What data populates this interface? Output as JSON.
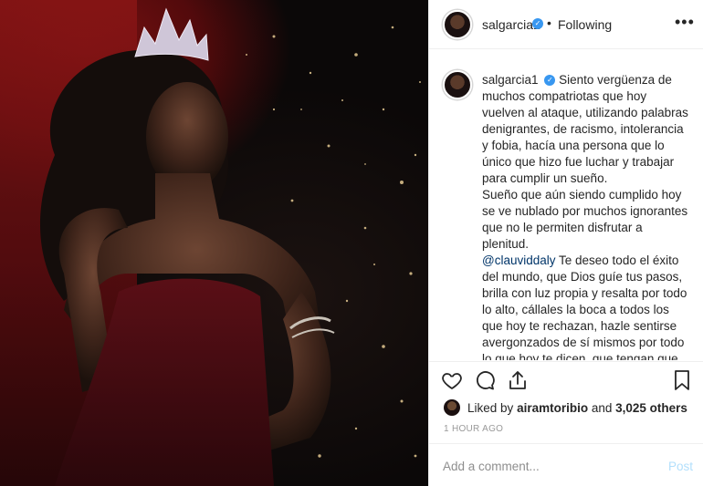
{
  "post": {
    "username": "salgarcia1",
    "follow_sep": "•",
    "follow_status": "Following",
    "more_glyph": "•••"
  },
  "caption": {
    "username": "salgarcia1",
    "paragraph1": "Siento vergüenza de muchos compatriotas que hoy vuelven al ataque, utilizando palabras denigrantes, de racismo, intolerancia y fobia, hacía una persona que lo único que hizo fue luchar y trabajar para cumplir un sueño.",
    "paragraph2": "Sueño que aún siendo cumplido hoy se ve nublado por muchos ignorantes que no le permiten disfrutar a plenitud.",
    "mention": "@clauviddaly",
    "paragraph3": "Te deseo todo el éxito del mundo, que Dios guíe tus pasos, brilla con luz propia y resalta por todo lo alto, cállales la boca a todos los que hoy te rechazan, hazle sentirse avergonzados de sí mismos por todo lo que hoy te dicen, que tengan que agachar la cabeza cuando les toque verte triunfar, cumple tu meta sin"
  },
  "likes": {
    "prefix": "Liked by",
    "user": "airamtoribio",
    "and": "and",
    "others": "3,025 others"
  },
  "timestamp": "1 HOUR AGO",
  "comment": {
    "placeholder": "Add a comment...",
    "post_label": "Post"
  },
  "icons": {
    "like": "heart-icon",
    "comment": "comment-icon",
    "share": "share-icon",
    "save": "bookmark-icon",
    "verified": "verified-badge-icon",
    "more": "more-options-icon"
  },
  "colors": {
    "verified": "#3897f0",
    "post_disabled": "#b2dffc",
    "mention": "#003569",
    "muted": "#999999"
  }
}
